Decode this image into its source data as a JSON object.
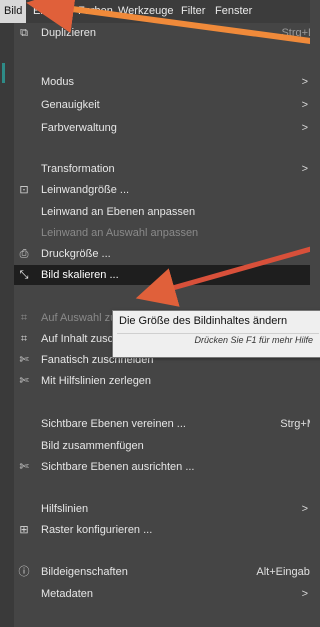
{
  "menubar": {
    "items": [
      "Bild",
      "Ebene",
      "Farben",
      "Werkzeuge",
      "Filter",
      "Fenster"
    ]
  },
  "menu": {
    "items": [
      {
        "label": "Duplizieren",
        "shortcut": "Strg+D",
        "icon": "duplicate-icon",
        "disabled": false
      },
      {
        "label": "Modus",
        "submenu": true
      },
      {
        "label": "Genauigkeit",
        "submenu": true
      },
      {
        "label": "Farbverwaltung",
        "submenu": true
      },
      {
        "label": "Transformation",
        "submenu": true
      },
      {
        "label": "Leinwandgröße ...",
        "icon": "canvas-size-icon"
      },
      {
        "label": "Leinwand an Ebenen anpassen"
      },
      {
        "label": "Leinwand an Auswahl anpassen",
        "disabled": true
      },
      {
        "label": "Druckgröße ...",
        "icon": "print-size-icon"
      },
      {
        "label": "Bild skalieren ...",
        "icon": "scale-image-icon",
        "highlighted": true
      },
      {
        "label": "Auf Auswahl zuschneiden",
        "icon": "crop-icon",
        "disabled": true
      },
      {
        "label": "Auf Inhalt zuschneiden",
        "icon": "crop-icon"
      },
      {
        "label": "Fanatisch zuschneiden",
        "icon": "zealous-crop-icon"
      },
      {
        "label": "Mit Hilfslinien zerlegen",
        "icon": "guillotine-icon"
      },
      {
        "label": "Sichtbare Ebenen vereinen ...",
        "shortcut": "Strg+M"
      },
      {
        "label": "Bild zusammenfügen"
      },
      {
        "label": "Sichtbare Ebenen ausrichten ...",
        "icon": "align-icon"
      },
      {
        "label": "Hilfslinien",
        "submenu": true
      },
      {
        "label": "Raster konfigurieren ...",
        "icon": "grid-icon"
      },
      {
        "label": "Bildeigenschaften",
        "shortcut": "Alt+Eingabe",
        "icon": "info-icon"
      },
      {
        "label": "Metadaten",
        "submenu": true
      }
    ]
  },
  "tooltip": {
    "text": "Die Größe des Bildinhaltes ändern",
    "hint": "Drücken Sie F1 für mehr Hilfe"
  },
  "annotation_color": "#e0603a"
}
